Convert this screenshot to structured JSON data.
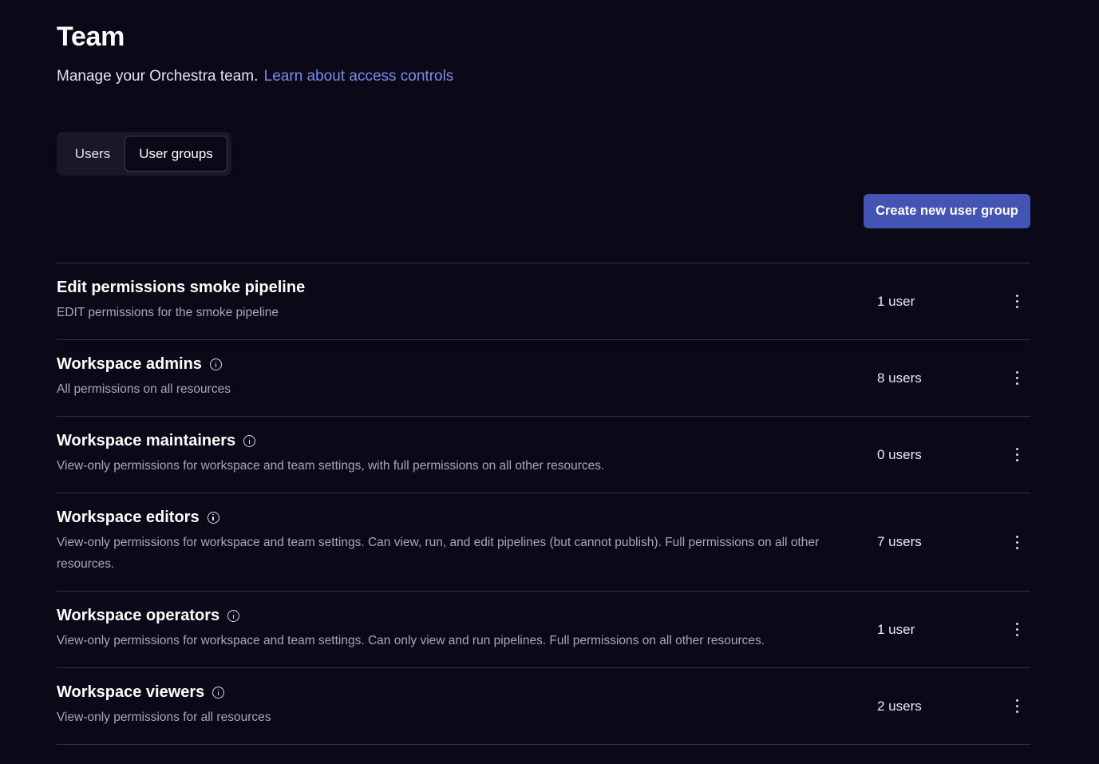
{
  "header": {
    "title": "Team",
    "subtitle": "Manage your Orchestra team.",
    "link": "Learn about access controls"
  },
  "tabs": [
    {
      "label": "Users",
      "active": false
    },
    {
      "label": "User groups",
      "active": true
    }
  ],
  "actions": {
    "create_label": "Create new user group"
  },
  "groups": [
    {
      "name": "Edit permissions smoke pipeline",
      "description": "EDIT permissions for the smoke pipeline",
      "count": "1 user",
      "has_info": false
    },
    {
      "name": "Workspace admins",
      "description": "All permissions on all resources",
      "count": "8 users",
      "has_info": true
    },
    {
      "name": "Workspace maintainers",
      "description": "View-only permissions for workspace and team settings, with full permissions on all other resources.",
      "count": "0 users",
      "has_info": true
    },
    {
      "name": "Workspace editors",
      "description": "View-only permissions for workspace and team settings. Can view, run, and edit pipelines (but cannot publish). Full permissions on all other resources.",
      "count": "7 users",
      "has_info": true
    },
    {
      "name": "Workspace operators",
      "description": "View-only permissions for workspace and team settings. Can only view and run pipelines. Full permissions on all other resources.",
      "count": "1 user",
      "has_info": true
    },
    {
      "name": "Workspace viewers",
      "description": "View-only permissions for all resources",
      "count": "2 users",
      "has_info": true
    }
  ],
  "colors": {
    "background": "#0b0818",
    "accent": "#4354b4",
    "link": "#7a8cf0"
  }
}
